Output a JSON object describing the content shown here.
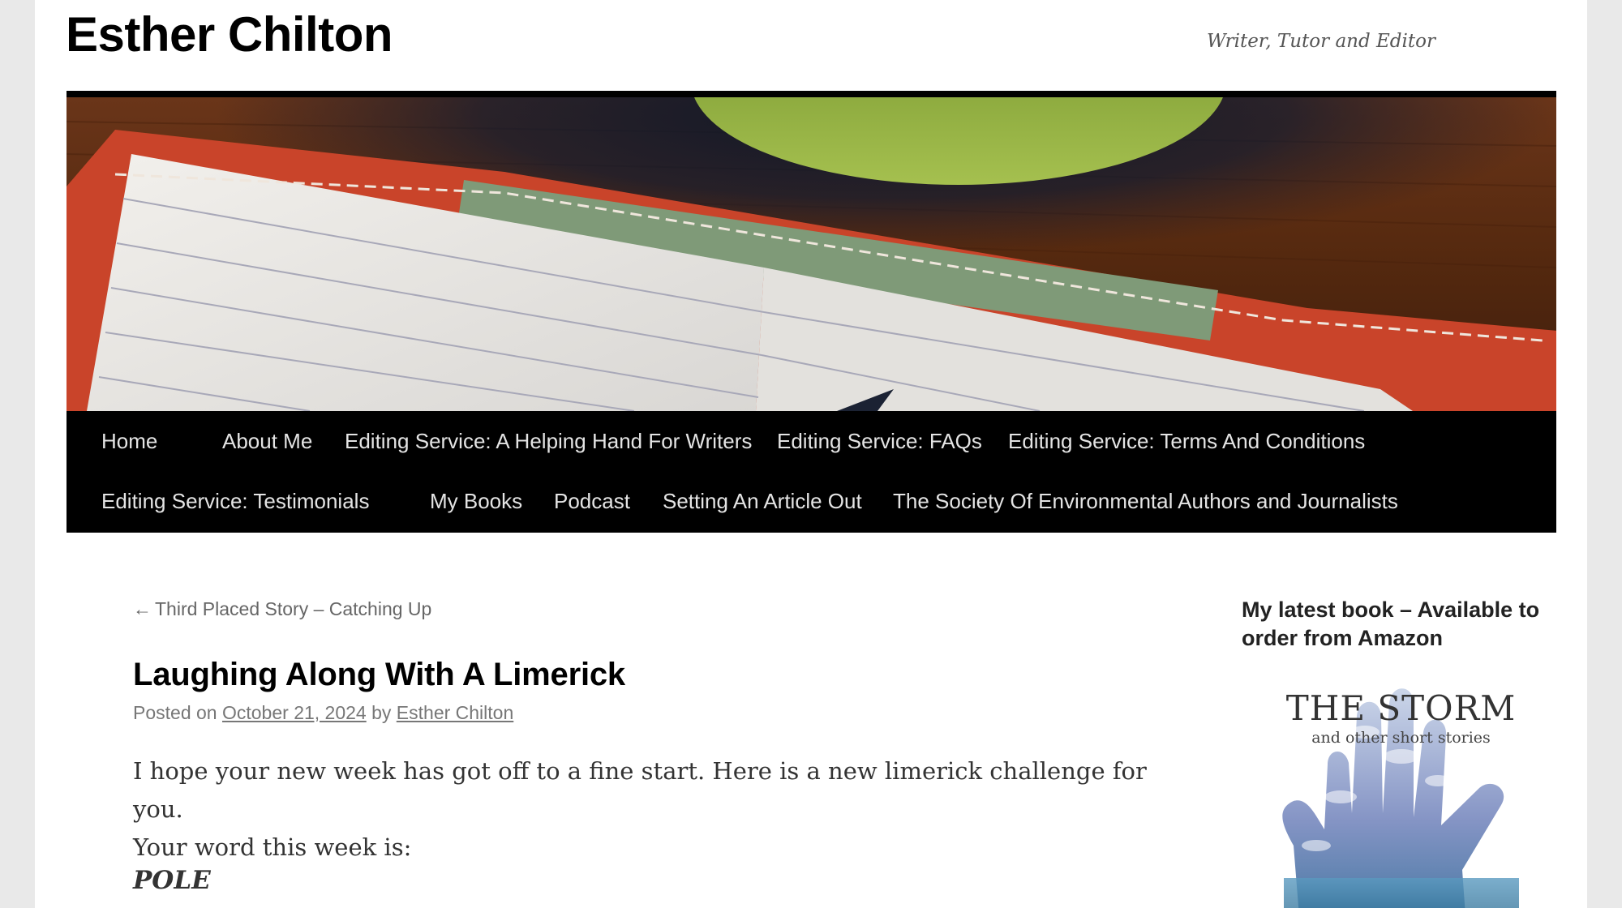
{
  "site": {
    "title": "Esther Chilton",
    "description": "Writer, Tutor and Editor"
  },
  "header_image": {
    "alt_colors": {
      "table": "#5e3018",
      "notebook": "#ce4a2c",
      "paper": "#e8e6e2",
      "cup": "#8aa63c",
      "ribbon": "#7f9a78"
    }
  },
  "nav": {
    "row1": [
      "Home",
      "About Me",
      "Editing Service: A Helping Hand For Writers",
      "Editing Service: FAQs",
      "Editing Service: Terms And Conditions"
    ],
    "row2": [
      "Editing Service: Testimonials",
      "My Books",
      "Podcast",
      "Setting An Article Out",
      "The Society Of Environmental Authors and Journalists"
    ]
  },
  "post_nav": {
    "previous_arrow": "←",
    "previous_label": "Third Placed Story – Catching Up"
  },
  "post": {
    "title": "Laughing Along With A Limerick",
    "posted_on": "Posted on",
    "date": "October 21, 2024",
    "by": "by",
    "author": "Esther Chilton",
    "body_line1": "I hope your new week has got off to a fine start. Here is a new limerick challenge for you.",
    "body_line2": "Your word this week is:",
    "word": "POLE"
  },
  "sidebar": {
    "widget_title": "My latest book – Available to order from Amazon",
    "book": {
      "title": "THE STORM",
      "subtitle": "and other short stories"
    }
  },
  "colors": {
    "page_bg": "#e9e9e9",
    "nav_bg": "#000000",
    "nav_text": "#e4e4e4",
    "link_meta": "#777777"
  }
}
